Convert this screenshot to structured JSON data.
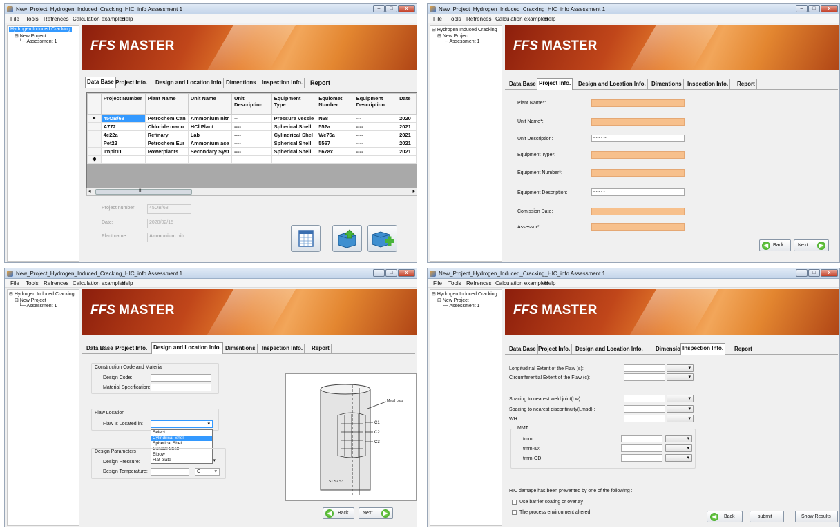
{
  "window": {
    "title": "New_Project_Hydrogen_Induced_Cracking_HIC_info Assessment 1"
  },
  "menu": [
    "File",
    "Tools",
    "Refrences",
    "Calculation examples",
    "Help"
  ],
  "tree": {
    "root": "Hydrogen Induced Cracking",
    "project": "New Project",
    "assessment": "Assessment 1"
  },
  "brand": {
    "logo_mark": "FFS",
    "logo_text": "MASTER"
  },
  "tabs_v1": [
    "Data Base",
    "Project Info.",
    "Design and Location Info",
    "Dimentions",
    "Inspection Info.",
    "Report"
  ],
  "tabs_v2": [
    "Data Base",
    "Project Info.",
    "Design and Location Info.",
    "Dimentions",
    "Inspection Info.",
    "Report"
  ],
  "tabs_v4": [
    "Data Dase",
    "Project Info.",
    "Design and Location Info.",
    "Dimension",
    "Inspection Info.",
    "Report"
  ],
  "database": {
    "columns": [
      "Project Number",
      "Plant Name",
      "Unit Name",
      "Unit Description",
      "Equipment Type",
      "Equiomet Number",
      "Equipment Description",
      "Date"
    ],
    "rows": [
      [
        "45OB/68",
        "Petrochem Can",
        "Ammonium nitr",
        "--",
        "Pressure Vessle",
        "N68",
        "---",
        "2020"
      ],
      [
        "A772",
        "Chloride manu",
        "HCl Plant",
        "----",
        "Spherical Shell",
        "552a",
        "----",
        "2021"
      ],
      [
        "4e22a",
        "Refinary",
        "Lab",
        "----",
        "Cylindrical Shel",
        "We76a",
        "----",
        "2021"
      ],
      [
        "Pet22",
        "Petrochem Eur",
        "Ammonium ace",
        "----",
        "Spherical Shell",
        "5567",
        "----",
        "2021"
      ],
      [
        "Irnplt11",
        "Powerplants",
        "Secondary Syst",
        "----",
        "Spherical Shell",
        "5678x",
        "----",
        "2021"
      ]
    ],
    "scroll_mark": "III",
    "summary": {
      "project_label": "Project number:",
      "project_value": "45OB/68",
      "date_label": "Date:",
      "date_value": "2020/02/15",
      "plant_label": "Plant name:",
      "plant_value": "Ammonium nitr"
    }
  },
  "project_info": {
    "fields": [
      {
        "label": "Plant Name*:",
        "value": ""
      },
      {
        "label": "Unit Name*:",
        "value": ""
      },
      {
        "label": "Unit Description:",
        "value": "- - - - --"
      },
      {
        "label": "Equipment Type*:",
        "value": ""
      },
      {
        "label": "Equipment Number*:",
        "value": ""
      },
      {
        "label": "Equipment Description:",
        "value": "- - - - -"
      },
      {
        "label": "Comission Date:",
        "value": ""
      },
      {
        "label": "Assessor*:",
        "value": ""
      }
    ]
  },
  "design": {
    "construction_group": "Construction Code and Material",
    "design_code": "Design Code:",
    "material_spec": "Material Specification:",
    "flaw_group": "Flaw Location",
    "flaw_label": "Flaw is Located in:",
    "flaw_options": [
      "Select",
      "Cylindrical Shell",
      "Spherical Shell",
      "Conical Shell",
      "Elbow",
      "Flat plate"
    ],
    "params_group": "Design Parameters",
    "pressure_label": "Design Pressure:",
    "temperature_label": "Design Temperature:",
    "temp_unit": "C",
    "diagram": {
      "metal_loss": "Metal Loss",
      "c1": "C1",
      "c2": "C2",
      "c3": "C3",
      "bottom": "S1 S2 S3"
    }
  },
  "inspection": {
    "longitudinal": "Longitudinal Extent of the Flaw (s):",
    "circumferential": "Circumferential Extent of the Flaw (c):",
    "weld": "Spacing to nearest weld joint(Lw) :",
    "discontinuity": "Spacing to nearest discontinuity(Lmsd) :",
    "wh": "WH",
    "mmt": "MMT",
    "tmm": "tmm:",
    "tmm_id": "tmm-ID:",
    "tmm_od": "tmm-OD:",
    "hic_text": "HIC damage has been prevented by one of the following :",
    "cb1": "Use barrier coating or overlay",
    "cb2": "The process environment altered"
  },
  "buttons": {
    "back": "Back",
    "next": "Next",
    "submit": "submit",
    "show_results": "Show Results"
  }
}
